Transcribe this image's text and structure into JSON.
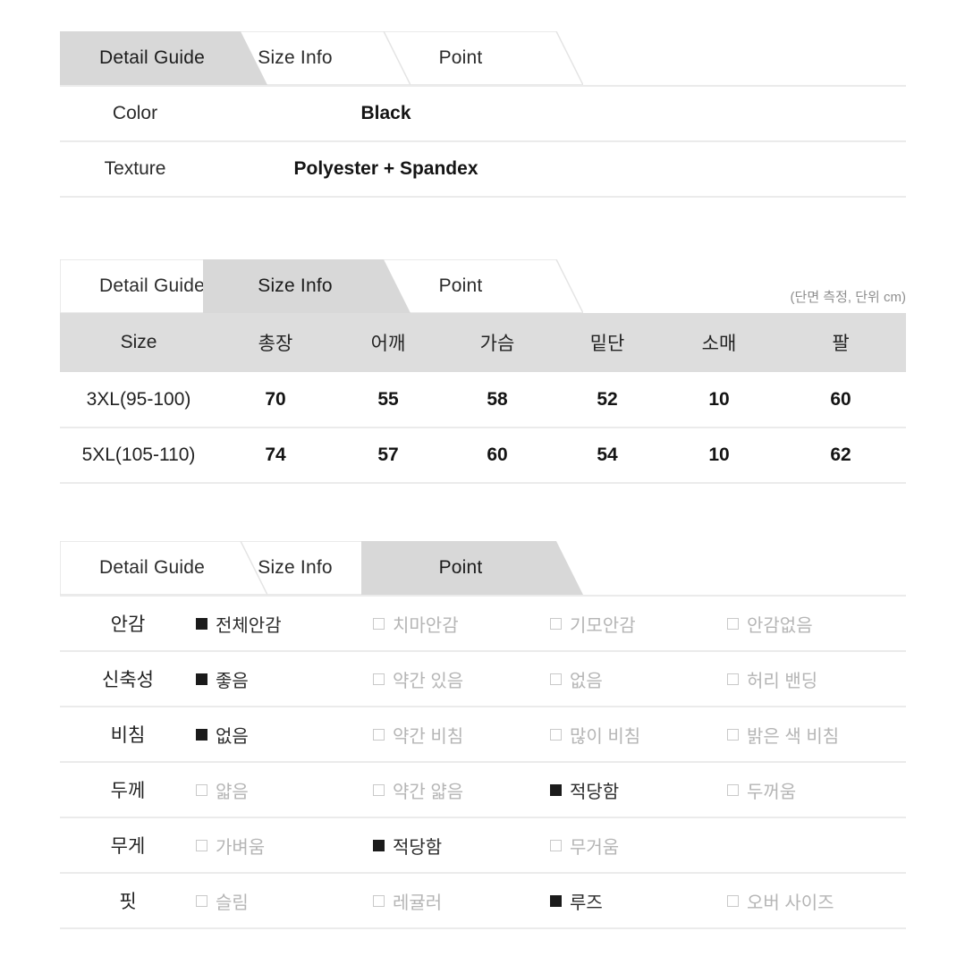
{
  "colors": {
    "active_tab_bg": "#d8d8d8",
    "inactive_tab_bg": "#ffffff",
    "header_bg": "#dddddd",
    "divider": "#ebebeb",
    "text": "#2b2b2b",
    "muted_text": "#b5b5b5"
  },
  "sections": {
    "detail_guide": {
      "tabs": [
        {
          "label": "Detail Guide",
          "active": true
        },
        {
          "label": "Size Info",
          "active": false
        },
        {
          "label": "Point",
          "active": false
        }
      ],
      "rows": [
        {
          "label": "Color",
          "value": "Black"
        },
        {
          "label": "Texture",
          "value": "Polyester + Spandex"
        }
      ]
    },
    "size_info": {
      "tabs": [
        {
          "label": "Detail Guide",
          "active": false
        },
        {
          "label": "Size Info",
          "active": true
        },
        {
          "label": "Point",
          "active": false
        }
      ],
      "unit_note": "(단면 측정, 단위 cm)",
      "columns": [
        "Size",
        "총장",
        "어깨",
        "가슴",
        "밑단",
        "소매",
        "팔"
      ],
      "rows": [
        {
          "size": "3XL(95-100)",
          "values": [
            "70",
            "55",
            "58",
            "52",
            "10",
            "60"
          ]
        },
        {
          "size": "5XL(105-110)",
          "values": [
            "74",
            "57",
            "60",
            "54",
            "10",
            "62"
          ]
        }
      ]
    },
    "point": {
      "tabs": [
        {
          "label": "Detail Guide",
          "active": false
        },
        {
          "label": "Size Info",
          "active": false
        },
        {
          "label": "Point",
          "active": true
        }
      ],
      "rows": [
        {
          "label": "안감",
          "options": [
            {
              "text": "전체안감",
              "selected": true
            },
            {
              "text": "치마안감",
              "selected": false
            },
            {
              "text": "기모안감",
              "selected": false
            },
            {
              "text": "안감없음",
              "selected": false
            }
          ]
        },
        {
          "label": "신축성",
          "options": [
            {
              "text": "좋음",
              "selected": true
            },
            {
              "text": "약간 있음",
              "selected": false
            },
            {
              "text": "없음",
              "selected": false
            },
            {
              "text": "허리 밴딩",
              "selected": false
            }
          ]
        },
        {
          "label": "비침",
          "options": [
            {
              "text": "없음",
              "selected": true
            },
            {
              "text": "약간 비침",
              "selected": false
            },
            {
              "text": "많이 비침",
              "selected": false
            },
            {
              "text": "밝은 색 비침",
              "selected": false
            }
          ]
        },
        {
          "label": "두께",
          "options": [
            {
              "text": "얇음",
              "selected": false
            },
            {
              "text": "약간 얇음",
              "selected": false
            },
            {
              "text": "적당함",
              "selected": true
            },
            {
              "text": "두꺼움",
              "selected": false
            }
          ]
        },
        {
          "label": "무게",
          "options": [
            {
              "text": "가벼움",
              "selected": false
            },
            {
              "text": "적당함",
              "selected": true
            },
            {
              "text": "무거움",
              "selected": false
            }
          ]
        },
        {
          "label": "핏",
          "options": [
            {
              "text": "슬림",
              "selected": false
            },
            {
              "text": "레귤러",
              "selected": false
            },
            {
              "text": "루즈",
              "selected": true
            },
            {
              "text": "오버 사이즈",
              "selected": false
            }
          ]
        }
      ]
    }
  }
}
